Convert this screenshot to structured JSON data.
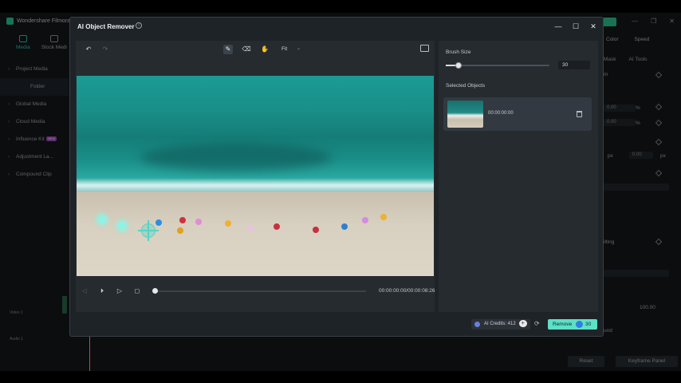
{
  "background_app": {
    "title": "Wondershare Filmora",
    "tabs": [
      {
        "label": "Media"
      },
      {
        "label": "Stock Medi"
      }
    ],
    "sidebar": [
      {
        "label": "Project Media"
      },
      {
        "label": "Folder"
      },
      {
        "label": "Global Media"
      },
      {
        "label": "Cloud Media"
      },
      {
        "label": "Influence Kit",
        "badge": "NEW"
      },
      {
        "label": "Adjustment La..."
      },
      {
        "label": "Compound Clip"
      }
    ],
    "right_tabs": [
      "Color",
      "Speed"
    ],
    "right_tabs2": [
      "Mask",
      "AI Tools"
    ],
    "right_fields": [
      "0.00",
      "%",
      "0.00",
      "%",
      "px",
      "0.00",
      "px"
    ],
    "right_panel_texts": [
      "m",
      "ilting",
      "100.00",
      "und"
    ],
    "buttons": {
      "reset": "Reset",
      "keyframe": "Keyframe Panel"
    },
    "track_labels": [
      "Video 1",
      "Audio 1"
    ]
  },
  "dialog": {
    "title": "AI Object Remover",
    "info_icon": "i",
    "controls": {
      "minimize": "—",
      "maximize": "☐",
      "close": "✕"
    },
    "toolbar": {
      "fit_select": "Fit"
    },
    "player": {
      "time_current": "00:00:00:00",
      "time_total": "00:00:08:26",
      "time_readout": "00:00:00:00/00:00:08:26",
      "progress": 0
    },
    "brush": {
      "label": "Brush Size",
      "value": "30",
      "fraction": 0.12
    },
    "selected": {
      "label": "Selected Objects",
      "items": [
        {
          "time": "00:00:00:00"
        }
      ]
    },
    "footer": {
      "credits_label": "AI Credits: 412",
      "plus": "+",
      "remove_label": "Remove",
      "remove_cost": "30"
    }
  },
  "colors": {
    "accent": "#5ce0c6",
    "teal": "#33d1c4",
    "brand": "#2bd4a6"
  }
}
